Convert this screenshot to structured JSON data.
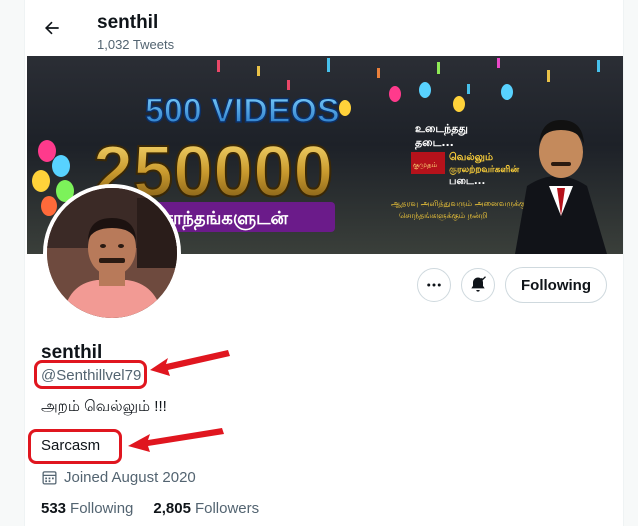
{
  "header": {
    "title": "senthil",
    "tweet_count": "1,032 Tweets"
  },
  "banner": {
    "headline_top": "500 VIDEOS",
    "headline_number": "250000",
    "headline_tamil": "சொந்தங்களுடன்",
    "right_text_1": "உடைந்தது",
    "right_text_2": "தடை...",
    "right_text_3": "வெல்லும்",
    "right_text_4": "குரலற்றவர்களின்",
    "right_text_5": "படை...",
    "bottom_text_1": "ஆதரவு அளித்துவரும் அனைவருக்கும்",
    "bottom_text_2": "சொந்தங்களுக்கும் நன்றி",
    "logo_text": "குமுதம்"
  },
  "actions": {
    "following_label": "Following"
  },
  "profile": {
    "display_name": "senthil",
    "handle": "@Senthillvel79",
    "bio": "அறம் வெல்லும் !!!",
    "category": "Sarcasm",
    "joined": "Joined August 2020",
    "following_count": "533",
    "following_label": "Following",
    "followers_count": "2,805",
    "followers_label": "Followers"
  },
  "colors": {
    "annotation": "#e0161f",
    "secondary_text": "#536471"
  }
}
